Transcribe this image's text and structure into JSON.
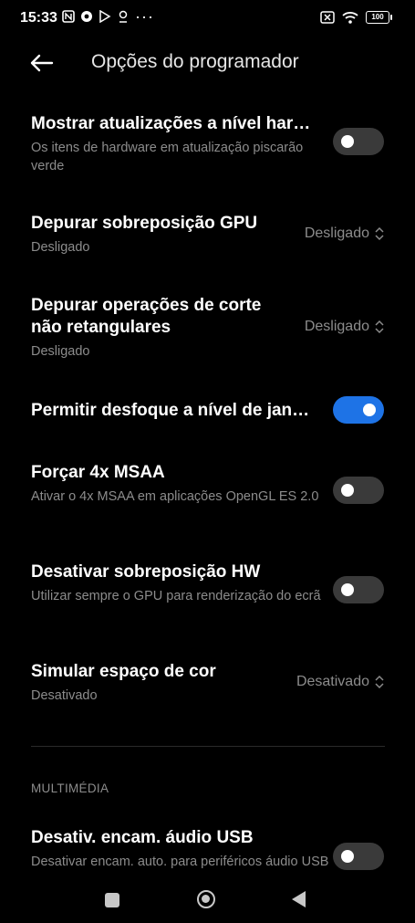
{
  "statusbar": {
    "time": "15:33",
    "dots": "···",
    "battery": "100",
    "icons": [
      "nfc-icon",
      "chrome-icon",
      "play-icon",
      "location-icon",
      "no-sim-icon",
      "wifi-icon",
      "battery-icon"
    ]
  },
  "header": {
    "title": "Opções do programador",
    "back_icon": "arrow-left-icon"
  },
  "settings": [
    {
      "title": "Mostrar atualizações a nível hardware",
      "subtitle": "Os itens de hardware em atualização piscarão verde",
      "control": "toggle",
      "on": false
    },
    {
      "title": "Depurar sobreposição GPU",
      "subtitle": "Desligado",
      "control": "select",
      "value": "Desligado"
    },
    {
      "title": "Depurar operações de corte não retangulares",
      "subtitle": "Desligado",
      "control": "select",
      "value": "Desligado"
    },
    {
      "title": "Permitir desfoque a nível de janela",
      "control": "toggle",
      "on": true
    },
    {
      "title": "Forçar 4x MSAA",
      "subtitle": "Ativar o 4x MSAA em aplicações OpenGL ES 2.0",
      "control": "toggle",
      "on": false
    },
    {
      "title": "Desativar sobreposição HW",
      "subtitle": "Utilizar sempre o GPU para renderização do ecrã",
      "control": "toggle",
      "on": false
    },
    {
      "title": "Simular espaço de cor",
      "subtitle": "Desativado",
      "control": "select",
      "value": "Desativado"
    }
  ],
  "section": {
    "label": "MULTIMÉDIA"
  },
  "multimedia": [
    {
      "title": "Desativ. encam. áudio USB",
      "subtitle": "Desativar encam. auto. para periféricos áudio USB",
      "control": "toggle",
      "on": false
    }
  ],
  "colors": {
    "accent": "#1e73e6",
    "toggle_off": "#3a3a3a",
    "secondary_text": "#8c8c8c"
  }
}
